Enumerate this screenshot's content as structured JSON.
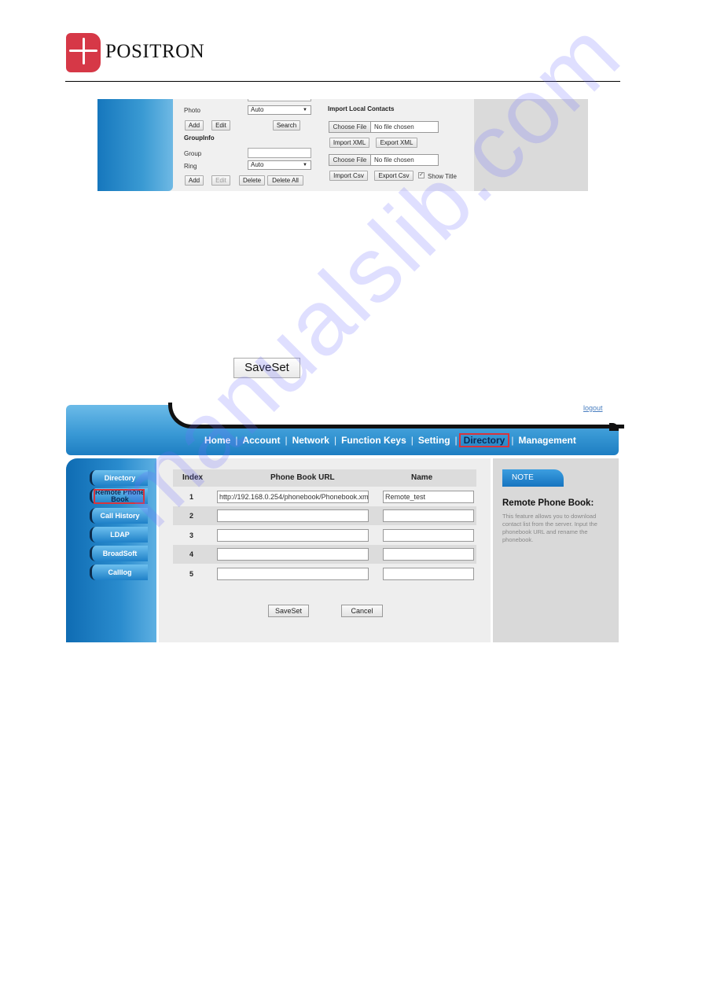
{
  "header": {
    "brand": "POSITRON",
    "logo_icon": "positron-logo-icon"
  },
  "contacts_screenshot": {
    "photo_label": "Photo",
    "photo_value": "Auto",
    "add_label": "Add",
    "edit_label": "Edit",
    "search_label": "Search",
    "groupinfo_heading": "GroupInfo",
    "group_label": "Group",
    "group_value": "",
    "ring_label": "Ring",
    "ring_value": "Auto",
    "add2_label": "Add",
    "edit2_label": "Edit",
    "delete_label": "Delete",
    "delete_all_label": "Delete All",
    "import_heading": "Import Local Contacts",
    "choose_file_label": "Choose File",
    "no_file_text": "No file chosen",
    "import_xml_label": "Import XML",
    "export_xml_label": "Export XML",
    "import_csv_label": "Import Csv",
    "export_csv_label": "Export Csv",
    "show_title_label": "Show Title",
    "show_title_checked": true
  },
  "standalone_button": {
    "label": "SaveSet"
  },
  "phonebook_screenshot": {
    "logout_label": "logout",
    "nav": [
      "Home",
      "Account",
      "Network",
      "Function Keys",
      "Setting",
      "Directory",
      "Management"
    ],
    "nav_active": "Directory",
    "sidebar": [
      "Directory",
      "Remote Phone Book",
      "Call History",
      "LDAP",
      "BroadSoft",
      "Calllog"
    ],
    "sidebar_active": "Remote Phone Book",
    "table": {
      "headers": [
        "Index",
        "Phone Book URL",
        "Name"
      ],
      "rows": [
        {
          "index": "1",
          "url": "http://192.168.0.254/phonebook/Phonebook.xm",
          "name": "Remote_test"
        },
        {
          "index": "2",
          "url": "",
          "name": ""
        },
        {
          "index": "3",
          "url": "",
          "name": ""
        },
        {
          "index": "4",
          "url": "",
          "name": ""
        },
        {
          "index": "5",
          "url": "",
          "name": ""
        }
      ]
    },
    "saveset_label": "SaveSet",
    "cancel_label": "Cancel",
    "note": {
      "tab": "NOTE",
      "title": "Remote Phone Book:",
      "text": "This feature allows you to download contact list from the server. Input the phonebook URL and rename the phonebook."
    },
    "accent_color": "#1e80c8",
    "highlight_color": "#d8343b"
  },
  "watermark": "manualslib.com"
}
